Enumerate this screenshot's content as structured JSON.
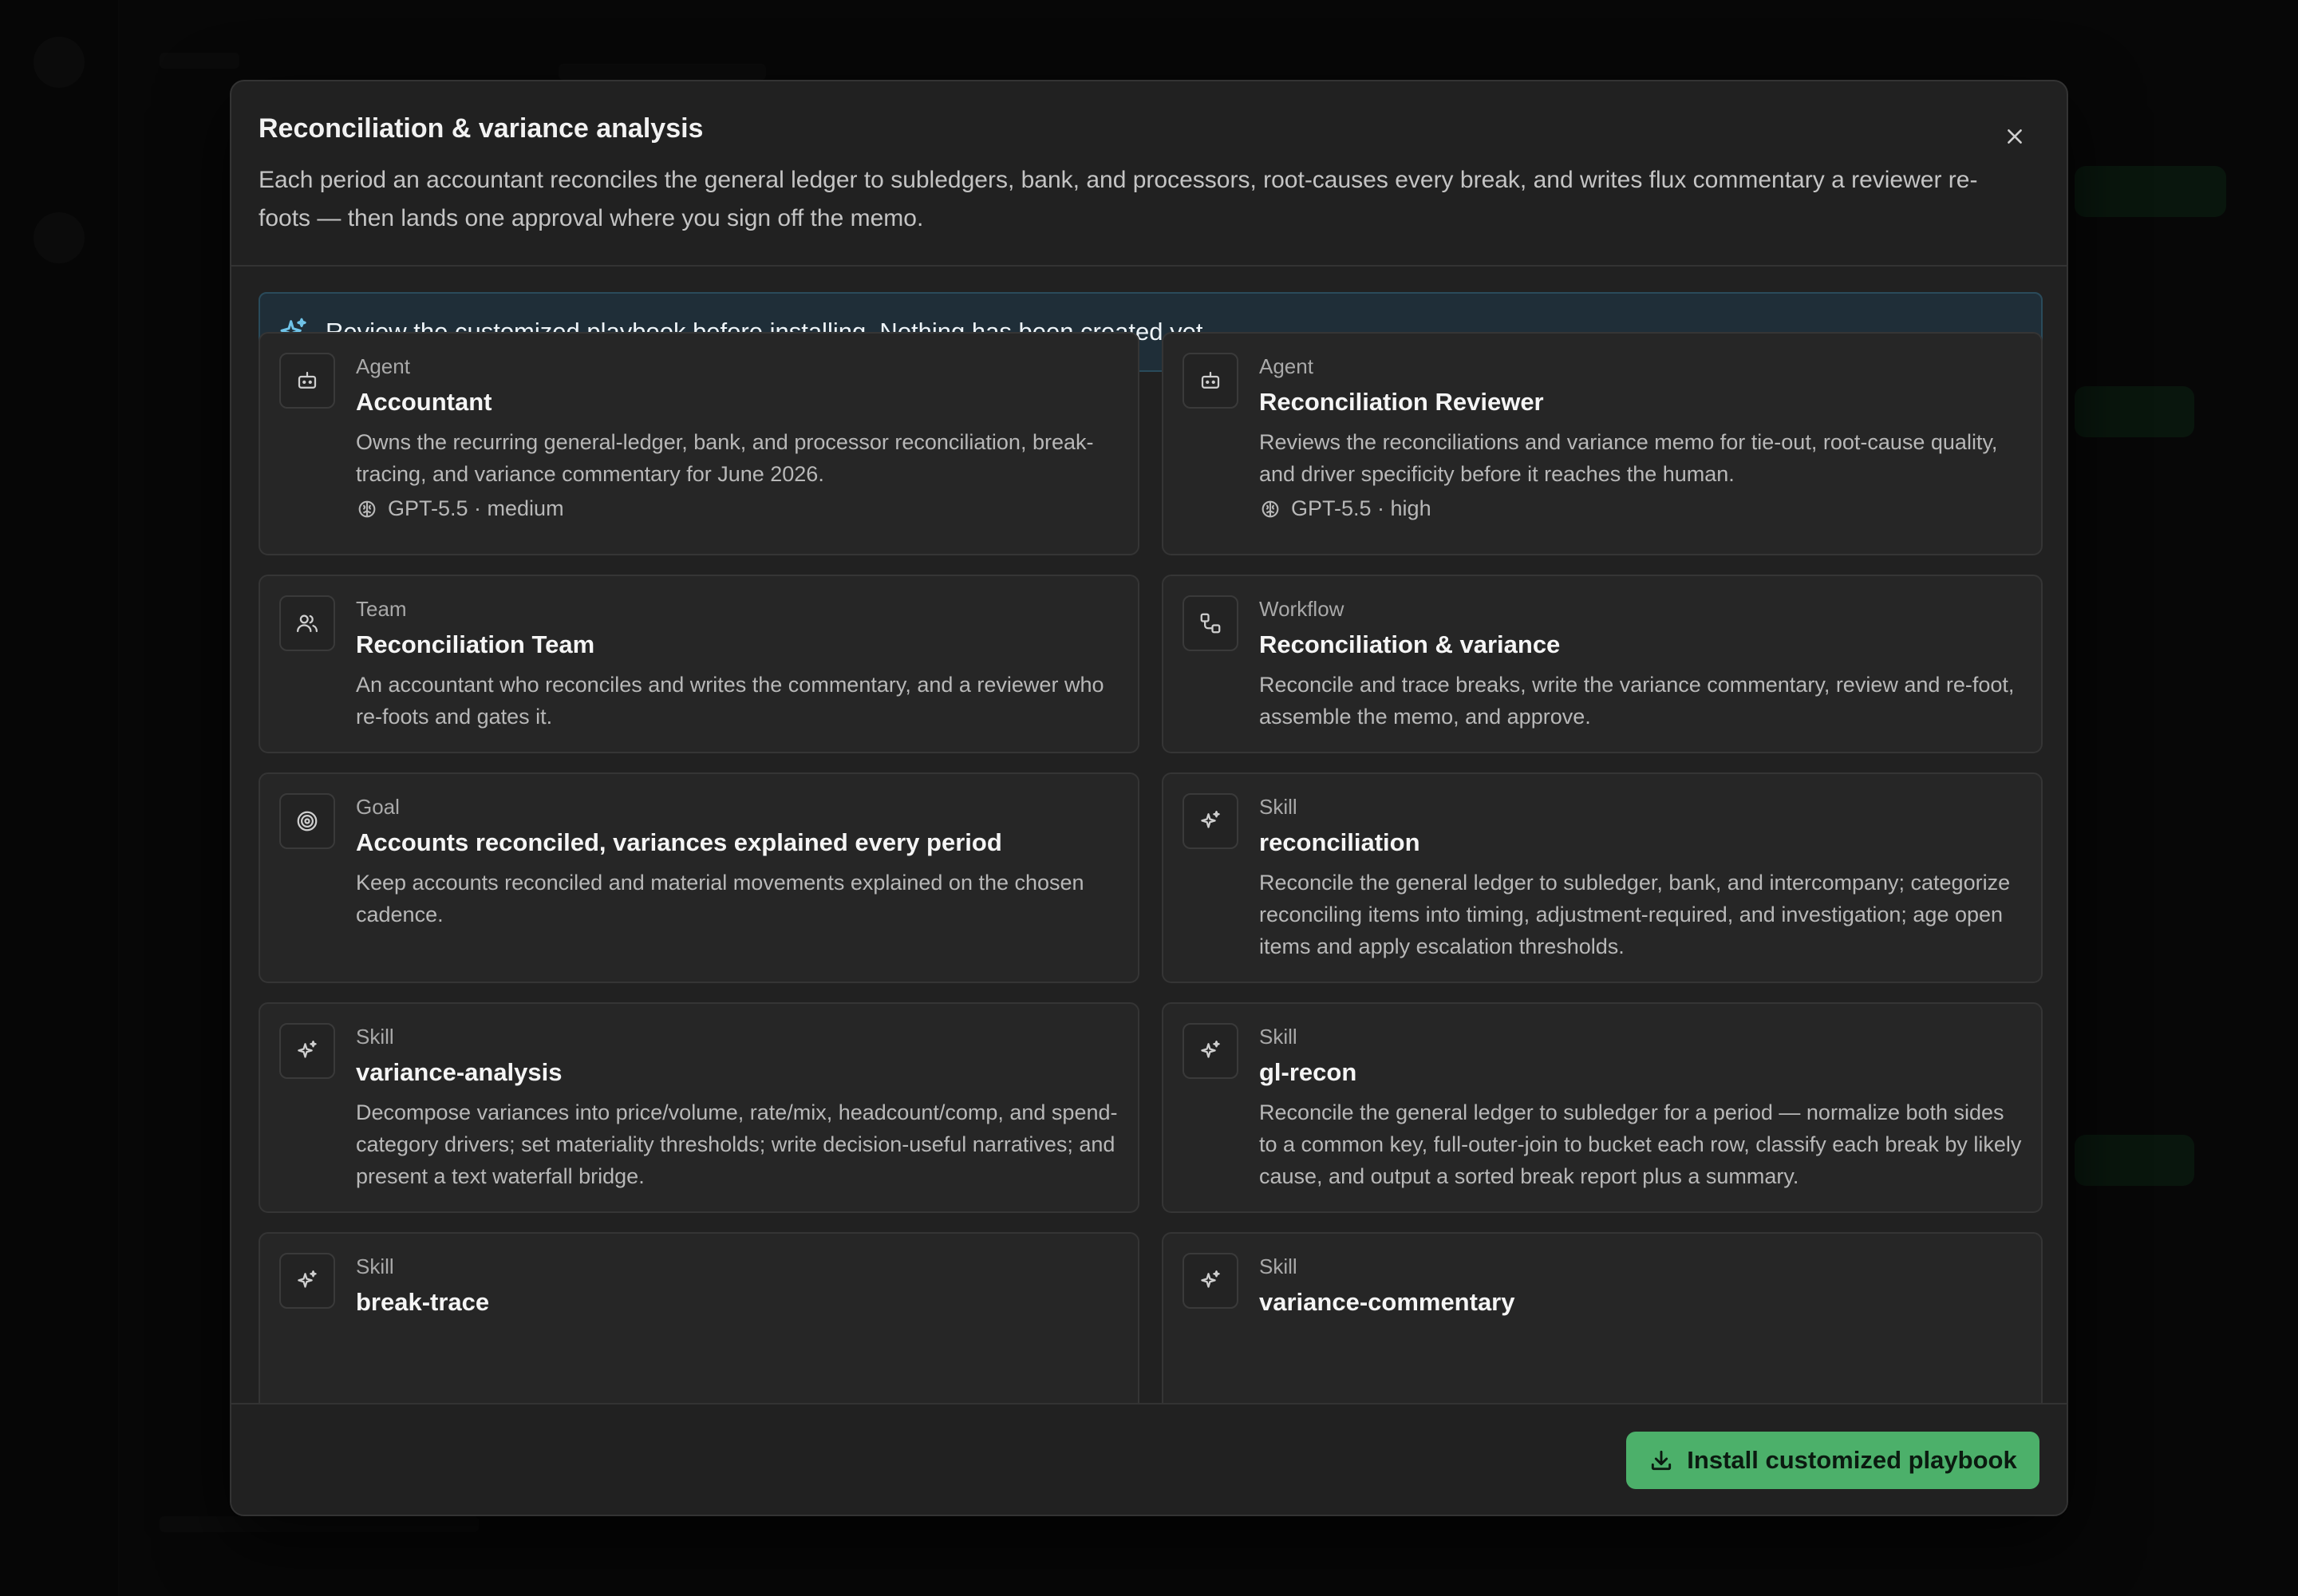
{
  "modal": {
    "title": "Reconciliation & variance analysis",
    "description": "Each period an accountant reconciles the general ledger to subledgers, bank, and processors, root-causes every break, and writes flux commentary a reviewer re-foots — then lands one approval where you sign off the memo.",
    "notice": "Review the customized playbook before installing. Nothing has been created yet.",
    "install_label": "Install customized playbook"
  },
  "cards": [
    {
      "kind": "Agent",
      "name": "Accountant",
      "description": "Owns the recurring general-ledger, bank, and processor reconciliation, break-tracing, and variance commentary for June 2026.",
      "model": "GPT-5.5 · medium",
      "icon": "bot-icon"
    },
    {
      "kind": "Agent",
      "name": "Reconciliation Reviewer",
      "description": "Reviews the reconciliations and variance memo for tie-out, root-cause quality, and driver specificity before it reaches the human.",
      "model": "GPT-5.5 · high",
      "icon": "bot-icon"
    },
    {
      "kind": "Team",
      "name": "Reconciliation Team",
      "description": "An accountant who reconciles and writes the commentary, and a reviewer who re-foots and gates it.",
      "icon": "users-icon"
    },
    {
      "kind": "Workflow",
      "name": "Reconciliation & variance",
      "description": "Reconcile and trace breaks, write the variance commentary, review and re-foot, assemble the memo, and approve.",
      "icon": "workflow-icon"
    },
    {
      "kind": "Goal",
      "name": "Accounts reconciled, variances explained every period",
      "description": "Keep accounts reconciled and material movements explained on the chosen cadence.",
      "icon": "target-icon"
    },
    {
      "kind": "Skill",
      "name": "reconciliation",
      "description": "Reconcile the general ledger to subledger, bank, and intercompany; categorize reconciling items into timing, adjustment-required, and investigation; age open items and apply escalation thresholds.",
      "icon": "sparkles-icon"
    },
    {
      "kind": "Skill",
      "name": "variance-analysis",
      "description": "Decompose variances into price/volume, rate/mix, headcount/comp, and spend-category drivers; set materiality thresholds; write decision-useful narratives; and present a text waterfall bridge.",
      "icon": "sparkles-icon"
    },
    {
      "kind": "Skill",
      "name": "gl-recon",
      "description": "Reconcile the general ledger to subledger for a period — normalize both sides to a common key, full-outer-join to bucket each row, classify each break by likely cause, and output a sorted break report plus a summary.",
      "icon": "sparkles-icon"
    },
    {
      "kind": "Skill",
      "name": "break-trace",
      "description": "",
      "icon": "sparkles-icon"
    },
    {
      "kind": "Skill",
      "name": "variance-commentary",
      "description": "",
      "icon": "sparkles-icon"
    }
  ]
}
